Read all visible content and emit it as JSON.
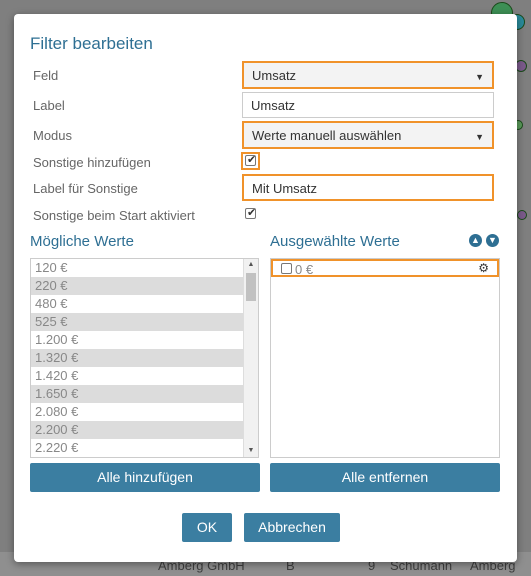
{
  "dialog": {
    "title": "Filter bearbeiten",
    "fields": {
      "feld_label": "Feld",
      "feld_value": "Umsatz",
      "label_label": "Label",
      "label_value": "Umsatz",
      "modus_label": "Modus",
      "modus_value": "Werte manuell auswählen",
      "sonstige_label": "Sonstige hinzufügen",
      "sonstige_checked": true,
      "label_sonstige_label": "Label für Sonstige",
      "label_sonstige_value": "Mit Umsatz",
      "sonstige_start_label": "Sonstige beim Start aktiviert",
      "sonstige_start_checked": true
    },
    "possible_values": {
      "title": "Mögliche Werte",
      "items": [
        "120 €",
        "220 €",
        "480 €",
        "525 €",
        "1.200 €",
        "1.320 €",
        "1.420 €",
        "1.650 €",
        "2.080 €",
        "2.200 €",
        "2.220 €"
      ],
      "add_all_label": "Alle hinzufügen"
    },
    "selected_values": {
      "title": "Ausgewählte Werte",
      "items": [
        {
          "label": "0 €",
          "checked": false
        }
      ],
      "remove_all_label": "Alle entfernen"
    },
    "ok_label": "OK",
    "cancel_label": "Abbrechen"
  },
  "background": {
    "table_row": [
      "Amberg GmbH",
      "B",
      "9",
      "Schumann",
      "Amberg"
    ]
  },
  "colors": {
    "accent": "#2e6f93",
    "button": "#3b7ea1",
    "highlight": "#f0922a"
  }
}
